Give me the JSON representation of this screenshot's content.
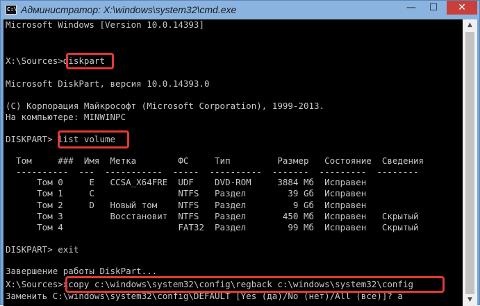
{
  "window": {
    "title": "Администратор: X:\\windows\\system32\\cmd.exe",
    "icon_label": "C:\\",
    "controls": {
      "minimize": "—",
      "maximize": "☐",
      "close": "✕"
    }
  },
  "console": {
    "lines": [
      "Microsoft Windows [Version 10.0.14393]",
      "",
      "",
      "X:\\Sources>diskpart",
      "",
      "Microsoft DiskPart, версия 10.0.14393.0",
      "",
      "(C) Корпорация Майкрософт (Microsoft Corporation), 1999-2013.",
      "На компьютере: MINWINPC",
      "",
      "DISKPART> list volume",
      "",
      "  Том     ###  Имя  Метка        ФС     Тип         Размер   Состояние  Сведения",
      "  ----------  ---  -----------  -----  ----------  -------  ---------  --------",
      "      Том 0     E   CCSA_X64FRE  UDF    DVD-ROM     3884 Мб  Исправен",
      "      Том 1     C                NTFS   Раздел        39 Gб  Исправен",
      "      Том 2     D   Новый том    NTFS   Раздел         9 Gб  Исправен",
      "      Том 3         Восстановит  NTFS   Раздел       450 Мб  Исправен   Скрытый",
      "      Том 4                      FAT32  Раздел        99 Мб  Исправен   Скрытый",
      "",
      "DISKPART> exit",
      "",
      "Завершение работы DiskPart...",
      "X:\\Sources>xcopy c:\\windows\\system32\\config\\regback c:\\windows\\system32\\config",
      "Заменить C:\\windows\\system32\\config\\DEFAULT [Yes (да)/No (нет)/All (все)]? a"
    ]
  },
  "scrollbar": {
    "up_arrow": "▲",
    "down_arrow": "▼"
  },
  "colors": {
    "console_bg": "#000000",
    "console_text": "#c8c8c8",
    "highlight": "#e53935",
    "titlebar": "#8bb3e0"
  }
}
